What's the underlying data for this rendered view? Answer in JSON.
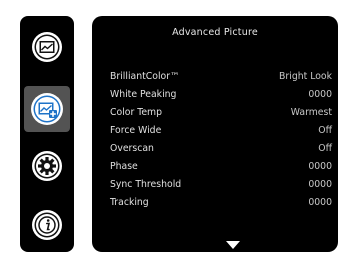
{
  "sidebar": {
    "items": [
      {
        "icon": "picture-icon",
        "selected": false
      },
      {
        "icon": "advanced-picture-icon",
        "selected": true
      },
      {
        "icon": "gear-icon",
        "selected": false
      },
      {
        "icon": "info-icon",
        "selected": false
      }
    ]
  },
  "panel": {
    "title": "Advanced Picture",
    "rows": [
      {
        "label": "BrilliantColor™",
        "value": "Bright Look"
      },
      {
        "label": "White Peaking",
        "value": "0000"
      },
      {
        "label": "Color Temp",
        "value": "Warmest"
      },
      {
        "label": "Force Wide",
        "value": "Off"
      },
      {
        "label": "Overscan",
        "value": "Off"
      },
      {
        "label": "Phase",
        "value": "0000"
      },
      {
        "label": "Sync Threshold",
        "value": "0000"
      },
      {
        "label": "Tracking",
        "value": "0000"
      }
    ],
    "more_indicator": "chevron-down-icon"
  },
  "colors": {
    "background": "#000000",
    "selected_item": "#535353",
    "text": "#e0e0e0",
    "accent_blue": "#1e73c8"
  }
}
